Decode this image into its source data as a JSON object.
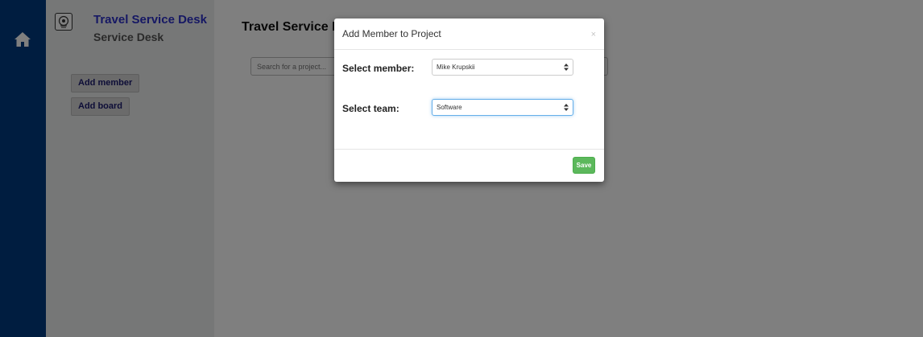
{
  "rail": {
    "home_icon": "home-icon"
  },
  "sidebar": {
    "logo_icon": "brain-gear-icon",
    "title": "Travel Service Desk",
    "subtitle": "Service Desk",
    "buttons": [
      {
        "label": "Add member"
      },
      {
        "label": "Add board"
      }
    ]
  },
  "main": {
    "title": "Travel Service Desk",
    "search_placeholder": "Search for a project..."
  },
  "modal": {
    "title": "Add Member to Project",
    "close_label": "×",
    "member_label": "Select member:",
    "member_value": "Mike Krupskii",
    "team_label": "Select team:",
    "team_value": "Software",
    "save_label": "Save"
  },
  "colors": {
    "rail": "#003b80",
    "sidebar": "#eceeee",
    "title_blue": "#2c30c8",
    "save_green": "#5cb85c"
  }
}
